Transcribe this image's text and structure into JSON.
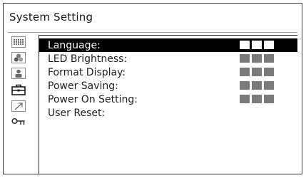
{
  "window": {
    "title": "System Setting"
  },
  "sidebar": {
    "icons": [
      {
        "name": "dots-grid-icon",
        "selected": false
      },
      {
        "name": "color-circles-icon",
        "selected": false
      },
      {
        "name": "person-icon",
        "selected": false
      },
      {
        "name": "toolbox-icon",
        "selected": true
      },
      {
        "name": "arrow-diagonal-icon",
        "selected": false
      },
      {
        "name": "key-icon",
        "selected": false
      }
    ]
  },
  "menu": {
    "items": [
      {
        "label": "Language:",
        "level_blocks": 3,
        "selected": true
      },
      {
        "label": "LED Brightness:",
        "level_blocks": 3,
        "selected": false
      },
      {
        "label": "Format Display:",
        "level_blocks": 3,
        "selected": false
      },
      {
        "label": "Power Saving:",
        "level_blocks": 3,
        "selected": false
      },
      {
        "label": "Power On Setting:",
        "level_blocks": 3,
        "selected": false
      },
      {
        "label": "User Reset:",
        "level_blocks": 0,
        "selected": false
      }
    ]
  },
  "colors": {
    "selection_bg": "#000000",
    "value_blocks": "#7a7a7a",
    "frame": "#3a3a3a"
  }
}
